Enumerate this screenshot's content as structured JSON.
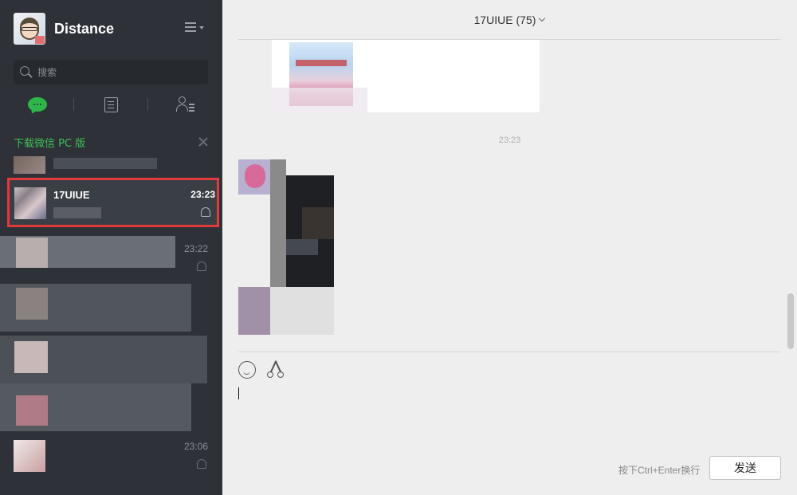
{
  "profile": {
    "username": "Distance"
  },
  "search": {
    "placeholder": "搜索"
  },
  "banner": {
    "download_text": "下载微信 PC 版"
  },
  "conversations": [
    {
      "name": "17UIUE",
      "time": "23:23",
      "active": true
    },
    {
      "name": "",
      "time": "23:22"
    },
    {
      "name": "",
      "time": "23:06"
    }
  ],
  "chat": {
    "title": "17UIUE (75)",
    "timestamp": "23:23"
  },
  "composer": {
    "hint": "按下Ctrl+Enter换行",
    "send_label": "发送"
  },
  "colors": {
    "sidebar_bg": "#2e3238",
    "accent_green": "#3fbf55",
    "highlight_border": "#e03a3a",
    "main_bg": "#eeeeee"
  }
}
